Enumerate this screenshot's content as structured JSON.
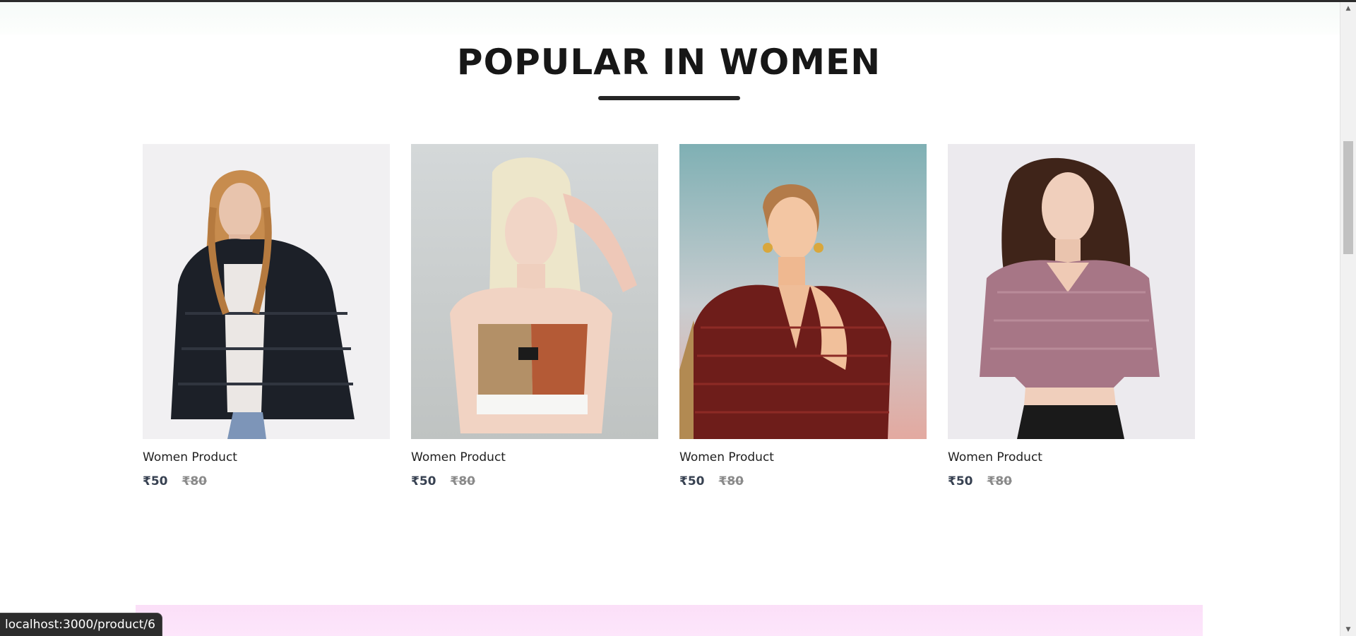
{
  "section": {
    "title": "POPULAR IN WOMEN"
  },
  "products": [
    {
      "name": "Women Product",
      "new_price": "₹50",
      "old_price": "₹80",
      "image": "woman-black-fur-jacket-photo"
    },
    {
      "name": "Women Product",
      "new_price": "₹50",
      "old_price": "₹80",
      "image": "woman-colorblock-crop-top-photo"
    },
    {
      "name": "Women Product",
      "new_price": "₹50",
      "old_price": "₹80",
      "image": "woman-red-patterned-wrap-dress-photo"
    },
    {
      "name": "Women Product",
      "new_price": "₹50",
      "old_price": "₹80",
      "image": "woman-mauve-puff-sleeve-top-photo"
    }
  ],
  "status_bar": {
    "link_preview": "localhost:3000/product/6"
  },
  "colors": {
    "title": "#171717",
    "price_new": "#374151",
    "price_old": "#8a8a8a",
    "promo_band": "#fbdff8"
  }
}
